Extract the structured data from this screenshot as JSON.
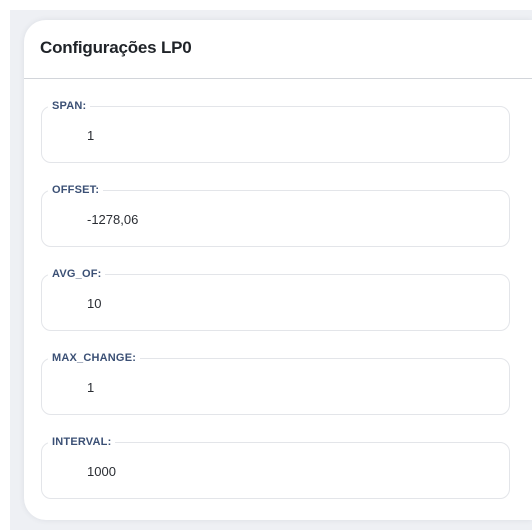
{
  "card": {
    "title": "Configurações LP0"
  },
  "fields": [
    {
      "label": "SPAN:",
      "value": "1"
    },
    {
      "label": "OFFSET:",
      "value": "-1278,06"
    },
    {
      "label": "AVG_OF:",
      "value": "10"
    },
    {
      "label": "MAX_CHANGE:",
      "value": "1"
    },
    {
      "label": "INTERVAL:",
      "value": "1000"
    }
  ]
}
